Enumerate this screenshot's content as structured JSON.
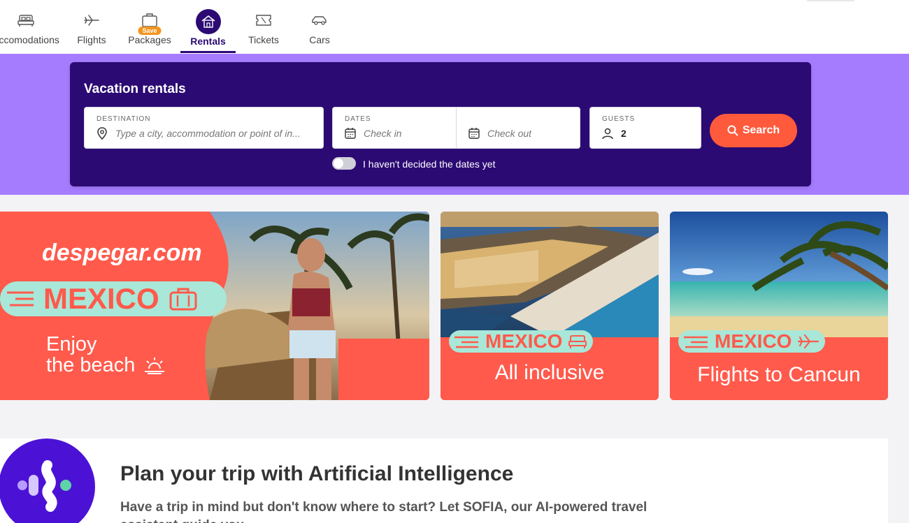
{
  "nav": {
    "items": [
      {
        "label": "Accomodations",
        "icon": "bed-icon"
      },
      {
        "label": "Flights",
        "icon": "plane-icon"
      },
      {
        "label": "Packages",
        "icon": "suitcase-icon",
        "badge": "Save"
      },
      {
        "label": "Rentals",
        "icon": "house-icon",
        "active": true
      },
      {
        "label": "Tickets",
        "icon": "ticket-icon"
      },
      {
        "label": "Cars",
        "icon": "car-icon"
      }
    ]
  },
  "search": {
    "title": "Vacation rentals",
    "destination_label": "DESTINATION",
    "destination_placeholder": "Type a city, accommodation or point of in...",
    "dates_label": "DATES",
    "checkin_placeholder": "Check in",
    "checkout_placeholder": "Check out",
    "guests_label": "GUESTS",
    "guests_value": "2",
    "button_label": "Search",
    "toggle_label": "I haven't decided the dates yet",
    "toggle_on": false
  },
  "banners": [
    {
      "brand": "despegar.com",
      "tag": "MEXICO",
      "subtitle_line1": "Enjoy",
      "subtitle_line2": "the beach"
    },
    {
      "tag": "MEXICO",
      "subtitle": "All inclusive"
    },
    {
      "tag": "MEXICO",
      "subtitle": "Flights to Cancun"
    }
  ],
  "ai": {
    "title": "Plan your trip with Artificial Intelligence",
    "description": "Have a trip in mind but don't know where to start? Let SOFIA, our AI-powered travel assistant guide you"
  },
  "colors": {
    "brand_dark": "#2b0a73",
    "band": "#a67cff",
    "accent": "#ff5a3c",
    "mint": "#a9e7d8"
  }
}
